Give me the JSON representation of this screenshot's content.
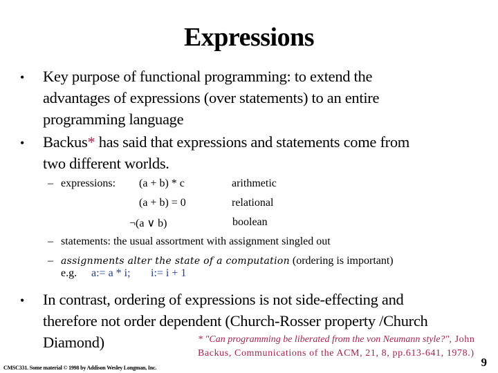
{
  "slide": {
    "title": "Expressions",
    "bullets": [
      {
        "lines": [
          "Key purpose of functional programming: to extend the",
          "advantages of expressions (over statements) to an entire",
          "programming language"
        ]
      },
      {
        "line1_pre": "Backus",
        "line1_star": "*",
        "line1_post": " has said that expressions and statements come from",
        "line2": "two different worlds."
      }
    ],
    "expressions": {
      "label": "expressions:",
      "rows": [
        {
          "expr": "(a + b) * c",
          "kind": "arithmetic"
        },
        {
          "expr": "(a + b) = 0",
          "kind": "relational"
        },
        {
          "expr": "¬(a ∨ b)",
          "kind": "boolean"
        }
      ]
    },
    "statements": "statements: the usual assortment with assignment singled out",
    "assignments": {
      "italic": "assignments alter the state of a computation",
      "normal": " (ordering is important)",
      "eg_label": "e.g.",
      "code1": "a:= a * i;",
      "code2": "i:= i + 1"
    },
    "bullet3": [
      "In contrast, ordering of expressions is not side-effecting and",
      "therefore not order dependent (Church-Rosser property /Church",
      "Diamond)"
    ],
    "dash_glyph": "–",
    "bullet_glyph": "•",
    "footnote": {
      "italic": "* \"Can programming be liberated from the von Neumann style?\"",
      "rest": ", John Backus, Communications of the ACM, 21, 8, pp.613-641, 1978.)"
    },
    "footer_left": "CMSC331.  Some material © 1998 by Addison Wesley Longman, Inc.",
    "page_number": "9"
  },
  "colors": {
    "accent_red": "#a2234f",
    "code_blue": "#233a8c"
  }
}
